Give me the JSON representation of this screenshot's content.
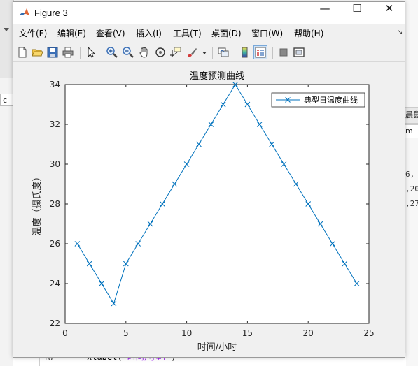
{
  "window": {
    "title": "Figure 3",
    "controls": {
      "minimize": "—",
      "maximize": "☐",
      "close": "✕"
    }
  },
  "menubar": {
    "items": [
      "文件(F)",
      "编辑(E)",
      "查看(V)",
      "插入(I)",
      "工具(T)",
      "桌面(D)",
      "窗口(W)",
      "帮助(H)"
    ],
    "overflow": "↘"
  },
  "toolbar": {
    "icons": [
      "new-figure-icon",
      "open-folder-icon",
      "save-icon",
      "print-icon",
      "pointer-icon",
      "zoom-in-icon",
      "zoom-out-icon",
      "pan-hand-icon",
      "rotate-3d-icon",
      "data-cursor-icon",
      "brush-icon",
      "link-plot-icon",
      "colorbar-icon",
      "legend-icon",
      "hide-plot-tools-icon",
      "show-plot-tools-icon"
    ]
  },
  "background": {
    "left_tab_text": "c",
    "right_tab_text": "晨鼠",
    "right_input_text": "m",
    "right_lines": [
      "6,",
      ",20",
      ",27"
    ],
    "line_number": "16",
    "code_fn": "xlabel(",
    "code_str": "'时间/小时'",
    "code_end": ")"
  },
  "colors": {
    "series": "#0072bd",
    "figure_bg": "#f0f0f0",
    "axes_bg": "#ffffff"
  },
  "chart_data": {
    "type": "line",
    "title": "温度预测曲线",
    "xlabel": "时间/小时",
    "ylabel": "温度（摄氏度）",
    "xlim": [
      0,
      25
    ],
    "ylim": [
      22,
      34
    ],
    "xticks": [
      0,
      5,
      10,
      15,
      20,
      25
    ],
    "yticks": [
      22,
      24,
      26,
      28,
      30,
      32,
      34
    ],
    "grid": false,
    "legend_position": "top-right",
    "series": [
      {
        "name": "典型日温度曲线",
        "marker": "x",
        "color": "#0072bd",
        "x": [
          1,
          2,
          3,
          4,
          5,
          6,
          7,
          8,
          9,
          10,
          11,
          12,
          13,
          14,
          15,
          16,
          17,
          18,
          19,
          20,
          21,
          22,
          23,
          24
        ],
        "y": [
          26,
          25,
          24,
          23,
          25,
          26,
          27,
          28,
          29,
          30,
          31,
          32,
          33,
          34,
          33,
          32,
          31,
          30,
          29,
          28,
          27,
          26,
          25,
          24
        ]
      }
    ]
  }
}
